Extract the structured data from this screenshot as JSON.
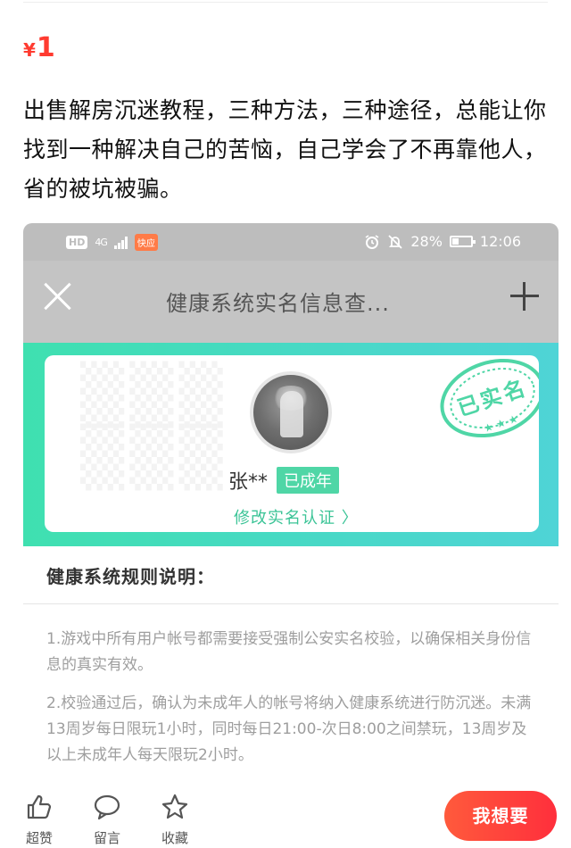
{
  "listing": {
    "currency": "¥",
    "price": "1",
    "description": "出售解房沉迷教程，三种方法，三种途径，总能让你找到一种解决自己的苦恼，自己学会了不再靠他人，省的被坑被骗。"
  },
  "screenshot": {
    "status_bar": {
      "hd": "HD",
      "network": "4G",
      "app_badge": "快应",
      "battery": "28%",
      "time": "12:06"
    },
    "nav": {
      "title": "健康系统实名信息查..."
    },
    "card": {
      "user_name": "张**",
      "adult_badge": "已成年",
      "edit_link": "修改实名认证 〉",
      "stamp_text": "已实名"
    },
    "rules": {
      "title": "健康系统规则说明：",
      "items": [
        "1.游戏中所有用户帐号都需要接受强制公安实名校验，以确保相关身份信息的真实有效。",
        "2.校验通过后，确认为未成年人的帐号将纳入健康系统进行防沉迷。未满13周岁每日限玩1小时，同时每日21:00-次日8:00之间禁玩，13周岁及以上未成年人每天限玩2小时。"
      ]
    }
  },
  "bottom_bar": {
    "like_label": "超赞",
    "message_label": "留言",
    "favorite_label": "收藏",
    "want_button": "我想要"
  },
  "colors": {
    "price": "#ff3b30",
    "accent_green": "#4fd6a6",
    "want_button": "#ff3b3c"
  },
  "icons": [
    "thumbs-up-icon",
    "chat-bubble-icon",
    "star-icon",
    "close-icon",
    "plus-icon",
    "alarm-icon",
    "mute-icon",
    "battery-icon"
  ]
}
